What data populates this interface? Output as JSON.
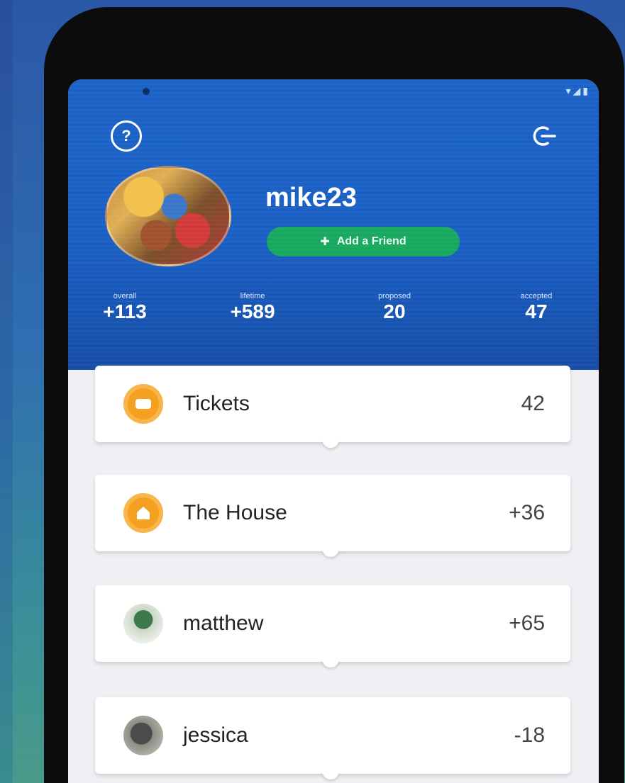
{
  "profile": {
    "username": "mike23",
    "add_friend_label": "Add a Friend"
  },
  "stats": [
    {
      "label": "overall",
      "value": "+113"
    },
    {
      "label": "lifetime",
      "value": "+589"
    },
    {
      "label": "proposed",
      "value": "20"
    },
    {
      "label": "accepted",
      "value": "47"
    }
  ],
  "list": [
    {
      "name": "Tickets",
      "amount": "42",
      "icon": "ticket-icon"
    },
    {
      "name": "The House",
      "amount": "+36",
      "icon": "house-icon"
    },
    {
      "name": "matthew",
      "amount": "+65",
      "icon": "avatar-matthew"
    },
    {
      "name": "jessica",
      "amount": "-18",
      "icon": "avatar-jessica"
    }
  ],
  "icons": {
    "help": "help-icon",
    "logout": "logout-icon",
    "add_friend": "add-user-icon"
  },
  "colors": {
    "header": "#1c63c7",
    "add_friend_button": "#19a860",
    "accent_orange": "#f6a021",
    "background": "#eef0f3"
  }
}
